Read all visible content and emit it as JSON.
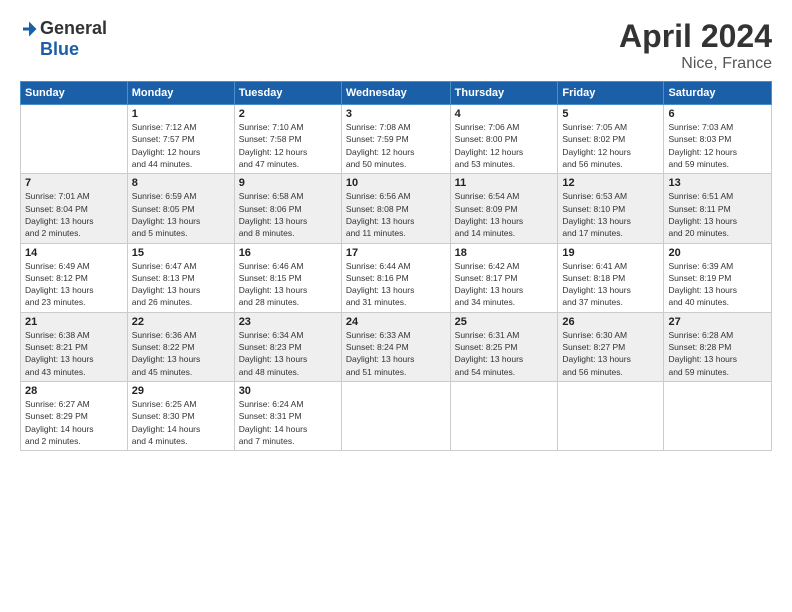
{
  "logo": {
    "general": "General",
    "blue": "Blue"
  },
  "title": "April 2024",
  "subtitle": "Nice, France",
  "headers": [
    "Sunday",
    "Monday",
    "Tuesday",
    "Wednesday",
    "Thursday",
    "Friday",
    "Saturday"
  ],
  "weeks": [
    [
      {
        "day": "",
        "info": ""
      },
      {
        "day": "1",
        "info": "Sunrise: 7:12 AM\nSunset: 7:57 PM\nDaylight: 12 hours\nand 44 minutes."
      },
      {
        "day": "2",
        "info": "Sunrise: 7:10 AM\nSunset: 7:58 PM\nDaylight: 12 hours\nand 47 minutes."
      },
      {
        "day": "3",
        "info": "Sunrise: 7:08 AM\nSunset: 7:59 PM\nDaylight: 12 hours\nand 50 minutes."
      },
      {
        "day": "4",
        "info": "Sunrise: 7:06 AM\nSunset: 8:00 PM\nDaylight: 12 hours\nand 53 minutes."
      },
      {
        "day": "5",
        "info": "Sunrise: 7:05 AM\nSunset: 8:02 PM\nDaylight: 12 hours\nand 56 minutes."
      },
      {
        "day": "6",
        "info": "Sunrise: 7:03 AM\nSunset: 8:03 PM\nDaylight: 12 hours\nand 59 minutes."
      }
    ],
    [
      {
        "day": "7",
        "info": "Sunrise: 7:01 AM\nSunset: 8:04 PM\nDaylight: 13 hours\nand 2 minutes."
      },
      {
        "day": "8",
        "info": "Sunrise: 6:59 AM\nSunset: 8:05 PM\nDaylight: 13 hours\nand 5 minutes."
      },
      {
        "day": "9",
        "info": "Sunrise: 6:58 AM\nSunset: 8:06 PM\nDaylight: 13 hours\nand 8 minutes."
      },
      {
        "day": "10",
        "info": "Sunrise: 6:56 AM\nSunset: 8:08 PM\nDaylight: 13 hours\nand 11 minutes."
      },
      {
        "day": "11",
        "info": "Sunrise: 6:54 AM\nSunset: 8:09 PM\nDaylight: 13 hours\nand 14 minutes."
      },
      {
        "day": "12",
        "info": "Sunrise: 6:53 AM\nSunset: 8:10 PM\nDaylight: 13 hours\nand 17 minutes."
      },
      {
        "day": "13",
        "info": "Sunrise: 6:51 AM\nSunset: 8:11 PM\nDaylight: 13 hours\nand 20 minutes."
      }
    ],
    [
      {
        "day": "14",
        "info": "Sunrise: 6:49 AM\nSunset: 8:12 PM\nDaylight: 13 hours\nand 23 minutes."
      },
      {
        "day": "15",
        "info": "Sunrise: 6:47 AM\nSunset: 8:13 PM\nDaylight: 13 hours\nand 26 minutes."
      },
      {
        "day": "16",
        "info": "Sunrise: 6:46 AM\nSunset: 8:15 PM\nDaylight: 13 hours\nand 28 minutes."
      },
      {
        "day": "17",
        "info": "Sunrise: 6:44 AM\nSunset: 8:16 PM\nDaylight: 13 hours\nand 31 minutes."
      },
      {
        "day": "18",
        "info": "Sunrise: 6:42 AM\nSunset: 8:17 PM\nDaylight: 13 hours\nand 34 minutes."
      },
      {
        "day": "19",
        "info": "Sunrise: 6:41 AM\nSunset: 8:18 PM\nDaylight: 13 hours\nand 37 minutes."
      },
      {
        "day": "20",
        "info": "Sunrise: 6:39 AM\nSunset: 8:19 PM\nDaylight: 13 hours\nand 40 minutes."
      }
    ],
    [
      {
        "day": "21",
        "info": "Sunrise: 6:38 AM\nSunset: 8:21 PM\nDaylight: 13 hours\nand 43 minutes."
      },
      {
        "day": "22",
        "info": "Sunrise: 6:36 AM\nSunset: 8:22 PM\nDaylight: 13 hours\nand 45 minutes."
      },
      {
        "day": "23",
        "info": "Sunrise: 6:34 AM\nSunset: 8:23 PM\nDaylight: 13 hours\nand 48 minutes."
      },
      {
        "day": "24",
        "info": "Sunrise: 6:33 AM\nSunset: 8:24 PM\nDaylight: 13 hours\nand 51 minutes."
      },
      {
        "day": "25",
        "info": "Sunrise: 6:31 AM\nSunset: 8:25 PM\nDaylight: 13 hours\nand 54 minutes."
      },
      {
        "day": "26",
        "info": "Sunrise: 6:30 AM\nSunset: 8:27 PM\nDaylight: 13 hours\nand 56 minutes."
      },
      {
        "day": "27",
        "info": "Sunrise: 6:28 AM\nSunset: 8:28 PM\nDaylight: 13 hours\nand 59 minutes."
      }
    ],
    [
      {
        "day": "28",
        "info": "Sunrise: 6:27 AM\nSunset: 8:29 PM\nDaylight: 14 hours\nand 2 minutes."
      },
      {
        "day": "29",
        "info": "Sunrise: 6:25 AM\nSunset: 8:30 PM\nDaylight: 14 hours\nand 4 minutes."
      },
      {
        "day": "30",
        "info": "Sunrise: 6:24 AM\nSunset: 8:31 PM\nDaylight: 14 hours\nand 7 minutes."
      },
      {
        "day": "",
        "info": ""
      },
      {
        "day": "",
        "info": ""
      },
      {
        "day": "",
        "info": ""
      },
      {
        "day": "",
        "info": ""
      }
    ]
  ]
}
